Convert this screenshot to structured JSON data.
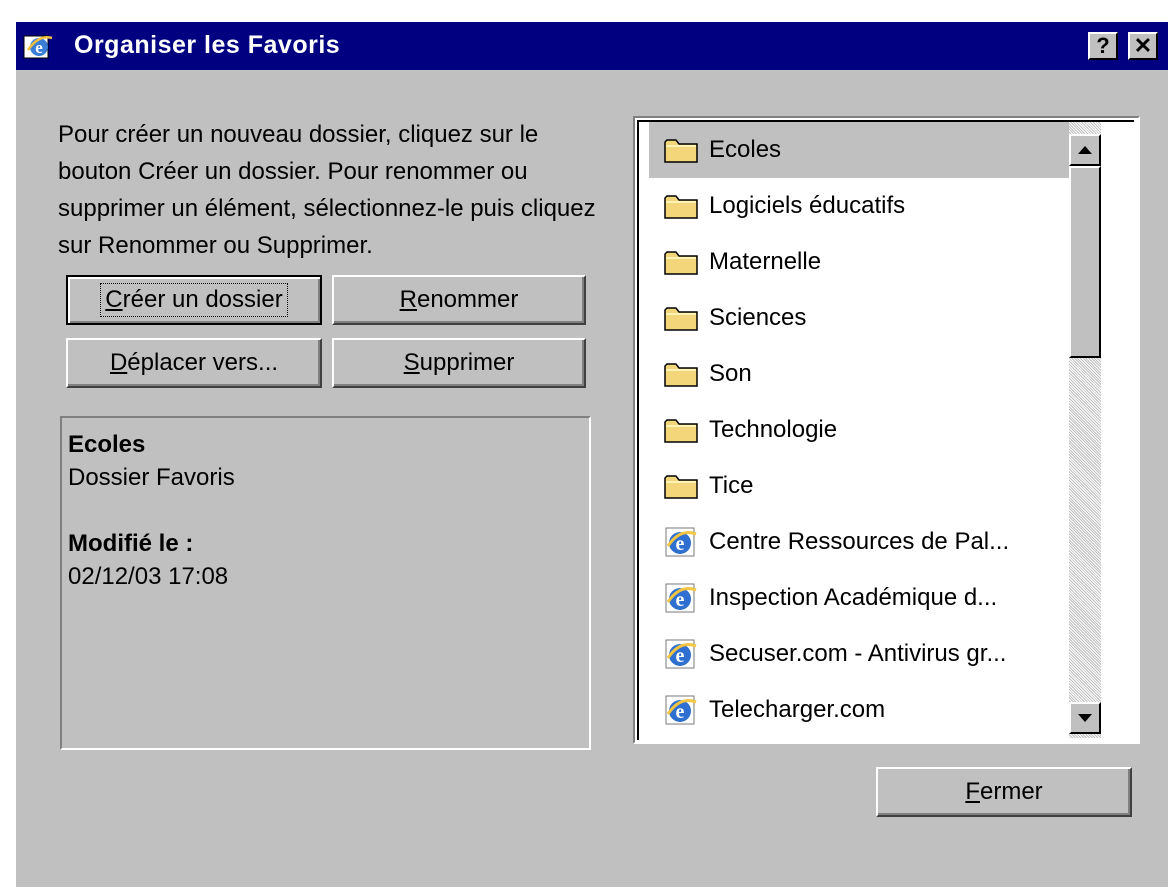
{
  "window": {
    "title": "Organiser les Favoris",
    "help_label": "?",
    "close_label": "✕"
  },
  "instructions": "Pour créer un nouveau dossier, cliquez sur le bouton Créer un dossier. Pour renommer ou supprimer un élément, sélectionnez-le puis cliquez sur Renommer ou Supprimer.",
  "buttons": {
    "create_folder": {
      "label": "Créer un dossier",
      "accel": "C",
      "rest": "réer un dossier"
    },
    "rename": {
      "label": "Renommer",
      "accel": "R",
      "rest": "enommer"
    },
    "move": {
      "label": "Déplacer vers...",
      "accel": "D",
      "rest": "éplacer vers..."
    },
    "delete": {
      "label": "Supprimer",
      "accel": "S",
      "rest": "upprimer"
    },
    "close": {
      "label": "Fermer",
      "accel": "F",
      "rest": "ermer"
    }
  },
  "details": {
    "name": "Ecoles",
    "type": "Dossier Favoris",
    "modified_label": "Modifié le :",
    "modified_value": "02/12/03 17:08"
  },
  "favorites": [
    {
      "label": "Ecoles",
      "kind": "folder-icon",
      "selected": true
    },
    {
      "label": "Logiciels éducatifs",
      "kind": "folder-icon",
      "selected": false
    },
    {
      "label": "Maternelle",
      "kind": "folder-icon",
      "selected": false
    },
    {
      "label": "Sciences",
      "kind": "folder-icon",
      "selected": false
    },
    {
      "label": "Son",
      "kind": "folder-icon",
      "selected": false
    },
    {
      "label": "Technologie",
      "kind": "folder-icon",
      "selected": false
    },
    {
      "label": "Tice",
      "kind": "folder-icon",
      "selected": false
    },
    {
      "label": "Centre Ressources de Pal...",
      "kind": "ie-link-icon",
      "selected": false
    },
    {
      "label": "Inspection Académique d...",
      "kind": "ie-link-icon",
      "selected": false
    },
    {
      "label": "Secuser.com - Antivirus gr...",
      "kind": "ie-link-icon",
      "selected": false
    },
    {
      "label": "Telecharger.com",
      "kind": "ie-link-icon",
      "selected": false
    }
  ],
  "colors": {
    "titlebar": "#000080",
    "face": "#c0c0c0",
    "folder": "#f4d67a"
  }
}
